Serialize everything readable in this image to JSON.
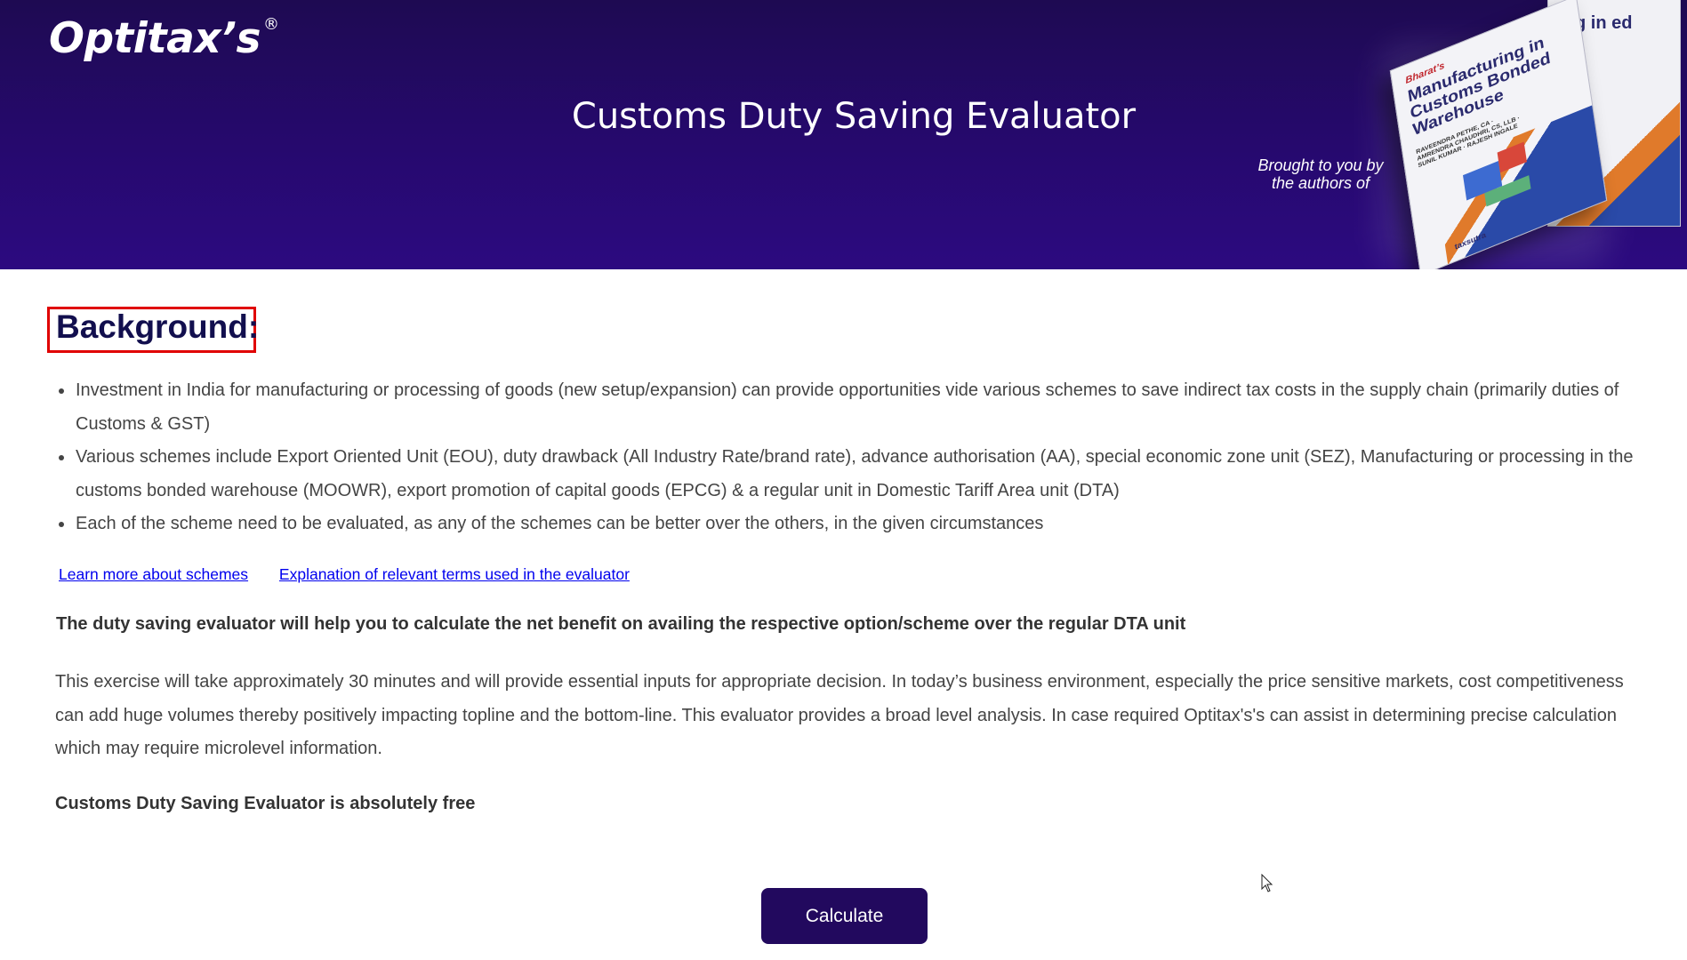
{
  "header": {
    "logo_text": "Optitax’s",
    "logo_mark": "®",
    "title": "Customs Duty Saving Evaluator",
    "brought_by_line1": "Brought to you by",
    "brought_by_line2": "the authors of",
    "book": {
      "brand": "Bharat’s",
      "title": "Manufacturing in Customs Bonded Warehouse",
      "back_title": "g in ed",
      "authors": "RAVEENDRA PETHE, CA · AMRENDRA CHAUDHRI, CS, LLB · SUNIL KUMAR · RAJESH INGALE",
      "publisher": "taxsutra"
    },
    "colors": {
      "header_bg": "#26096e",
      "accent": "#22095e"
    }
  },
  "background": {
    "heading": "Background:",
    "bullets": [
      "Investment in India for manufacturing or processing of goods (new setup/expansion) can provide opportunities vide various schemes to save indirect tax costs in the supply chain (primarily duties of Customs & GST)",
      "Various schemes include Export Oriented Unit (EOU), duty drawback (All Industry Rate/brand rate), advance authorisation (AA), special economic zone unit (SEZ), Manufacturing or processing in the customs bonded warehouse (MOOWR), export promotion of capital goods (EPCG) & a regular unit in Domestic Tariff Area unit (DTA)",
      "Each of the scheme need to be evaluated, as any of the schemes can be better over the others, in the given circumstances"
    ]
  },
  "links": {
    "learn_more": "Learn more about schemes",
    "explanation": "Explanation of relevant terms used in the evaluator"
  },
  "intro_bold": "The duty saving evaluator will help you to calculate the net benefit on availing the respective option/scheme over the regular DTA unit",
  "paragraph": "This exercise will take approximately 30 minutes and will provide essential inputs for appropriate decision. In today’s business environment, especially the price sensitive markets, cost competitiveness can add huge volumes thereby positively impacting topline and the bottom-line. This evaluator provides a broad level analysis. In case required Optitax's's can assist in determining precise calculation which may require microlevel information.",
  "free_note": "Customs Duty Saving Evaluator is absolutely free",
  "calculate_button": "Calculate"
}
